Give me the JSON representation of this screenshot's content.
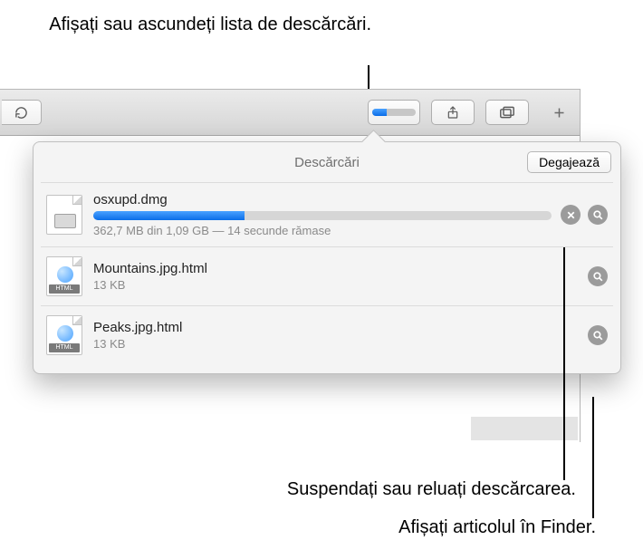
{
  "callouts": {
    "top": "Afișați sau ascundeți lista de descărcări.",
    "mid": "Suspendați sau reluați descărcarea.",
    "bot": "Afișați articolul în Finder."
  },
  "toolbar": {
    "downloads_progress_percent": 33
  },
  "popover": {
    "title": "Descărcări",
    "clear_label": "Degajează"
  },
  "downloads": [
    {
      "name": "osxupd.dmg",
      "status": "362,7 MB din 1,09 GB — 14 secunde rămase",
      "progress_percent": 33,
      "in_progress": true,
      "kind": "dmg"
    },
    {
      "name": "Mountains.jpg.html",
      "status": "13 KB",
      "in_progress": false,
      "kind": "html"
    },
    {
      "name": "Peaks.jpg.html",
      "status": "13 KB",
      "in_progress": false,
      "kind": "html"
    }
  ],
  "icon_labels": {
    "html_badge": "HTML"
  }
}
